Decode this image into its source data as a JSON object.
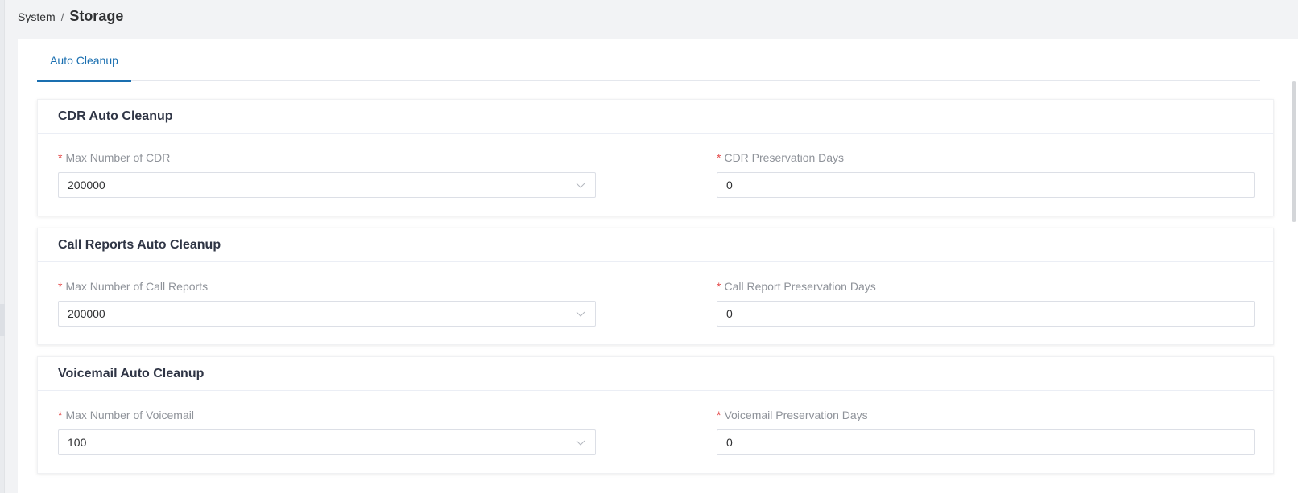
{
  "breadcrumb": {
    "parent": "System",
    "separator": "/",
    "current": "Storage"
  },
  "tabs": [
    {
      "label": "Auto Cleanup",
      "active": true
    }
  ],
  "required_mark": "*",
  "accent_color": "#1a6fb0",
  "sections": [
    {
      "title": "CDR Auto Cleanup",
      "left": {
        "label": "Max Number of CDR",
        "value": "200000",
        "type": "select"
      },
      "right": {
        "label": "CDR Preservation Days",
        "value": "0",
        "type": "input"
      }
    },
    {
      "title": "Call Reports Auto Cleanup",
      "left": {
        "label": "Max Number of Call Reports",
        "value": "200000",
        "type": "select"
      },
      "right": {
        "label": "Call Report Preservation Days",
        "value": "0",
        "type": "input"
      }
    },
    {
      "title": "Voicemail Auto Cleanup",
      "left": {
        "label": "Max Number of Voicemail",
        "value": "100",
        "type": "select"
      },
      "right": {
        "label": "Voicemail Preservation Days",
        "value": "0",
        "type": "input"
      }
    }
  ]
}
